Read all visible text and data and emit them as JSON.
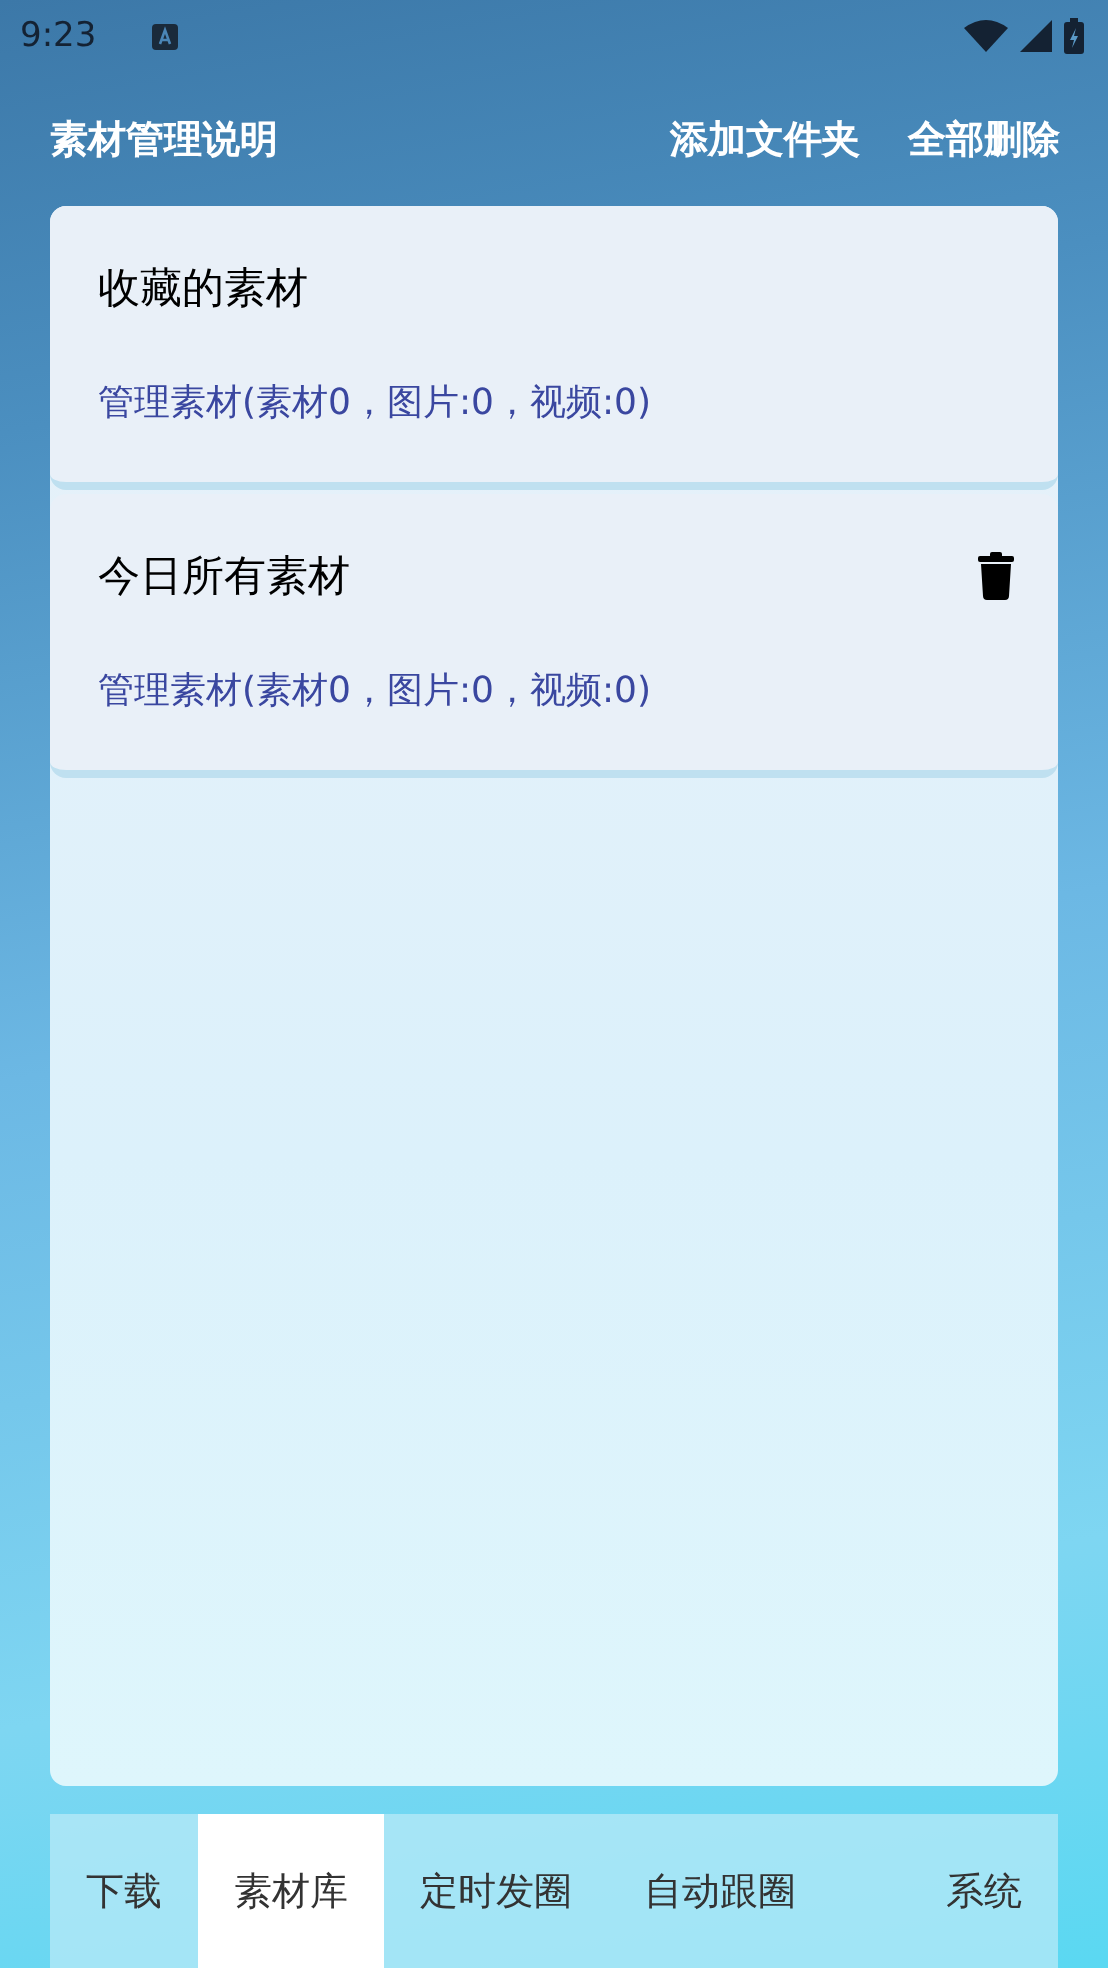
{
  "status_bar": {
    "time": "9:23"
  },
  "header": {
    "title": "素材管理说明",
    "actions": [
      "添加文件夹",
      "全部删除"
    ]
  },
  "folders": [
    {
      "name": "收藏的素材",
      "summary": "管理素材(素材0，图片:0，视频:0)",
      "deletable": false
    },
    {
      "name": "今日所有素材",
      "summary": "管理素材(素材0，图片:0，视频:0)",
      "deletable": true
    }
  ],
  "tabs": [
    {
      "label": "下载",
      "selected": false
    },
    {
      "label": "素材库",
      "selected": true
    },
    {
      "label": "定时发圈",
      "selected": false
    },
    {
      "label": "自动跟圈",
      "selected": false
    },
    {
      "label": "系统",
      "selected": false
    }
  ]
}
